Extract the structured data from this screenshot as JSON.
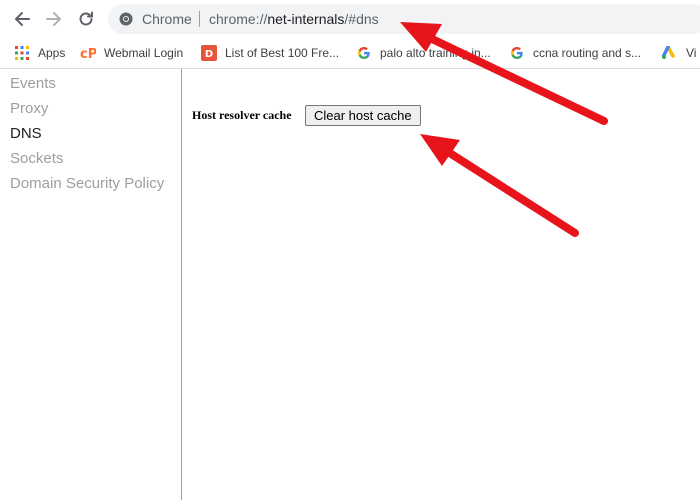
{
  "toolbar": {
    "back_icon": "back-arrow-icon",
    "forward_icon": "forward-arrow-icon",
    "reload_icon": "reload-icon",
    "omnibox": {
      "chip_label": "Chrome",
      "url_scheme": "chrome://",
      "url_host": "net-internals",
      "url_path": "/#dns"
    }
  },
  "bookmarks": [
    {
      "label": "Apps",
      "icon": "apps-grid-icon"
    },
    {
      "label": "Webmail Login",
      "icon": "cpanel-icon"
    },
    {
      "label": "List of Best 100 Fre...",
      "icon": "d-favicon-icon"
    },
    {
      "label": "palo alto training in...",
      "icon": "google-icon"
    },
    {
      "label": "ccna routing and s...",
      "icon": "google-icon"
    },
    {
      "label": "Vi",
      "icon": "google-ads-icon"
    }
  ],
  "sidebar": {
    "items": [
      {
        "label": "Events",
        "active": false
      },
      {
        "label": "Proxy",
        "active": false
      },
      {
        "label": "DNS",
        "active": true
      },
      {
        "label": "Sockets",
        "active": false
      },
      {
        "label": "Domain Security Policy",
        "active": false
      }
    ]
  },
  "dns_panel": {
    "cache_label": "Host resolver cache",
    "clear_button_label": "Clear host cache"
  },
  "colors": {
    "annotation_arrow": "#e8141b",
    "sidebar_inactive": "#9e9e9e",
    "sidebar_active": "#202124",
    "omnibox_bg": "#f1f3f4"
  }
}
